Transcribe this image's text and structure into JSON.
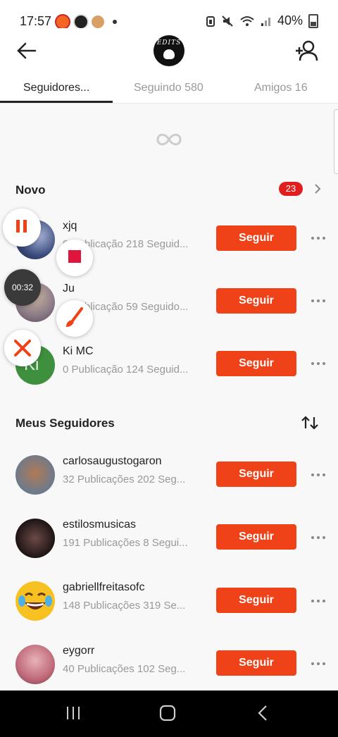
{
  "status_bar": {
    "time": "17:57",
    "battery": "40%"
  },
  "tabs": [
    {
      "label": "Seguidores..."
    },
    {
      "label": "Seguindo 580"
    },
    {
      "label": "Amigos 16"
    }
  ],
  "logo_text": "EDITS",
  "new_section": {
    "title": "Novo",
    "badge": "23",
    "users": [
      {
        "name": "xjq",
        "meta": "0 Publicação   218 Seguid...",
        "button": "Seguir"
      },
      {
        "name": "Ju",
        "meta": "0 Publicação   59 Seguido...",
        "button": "Seguir"
      },
      {
        "name": "Ki MC",
        "meta": "0 Publicação   124 Seguid...",
        "button": "Seguir",
        "initials": "Ki"
      }
    ]
  },
  "followers_section": {
    "title": "Meus Seguidores",
    "users": [
      {
        "name": "carlosaugustogaron",
        "meta": "32 Publicações   202 Seg...",
        "button": "Seguir"
      },
      {
        "name": "estilosmusicas",
        "meta": "191 Publicações   8 Segui...",
        "button": "Seguir"
      },
      {
        "name": "gabriellfreitasofc",
        "meta": "148 Publicações   319 Se...",
        "button": "Seguir"
      },
      {
        "name": "eygorr",
        "meta": "40 Publicações   102 Seg...",
        "button": "Seguir"
      }
    ]
  },
  "recorder": {
    "timer": "00:32"
  },
  "colors": {
    "accent": "#ef4219",
    "badge": "#e01e1e"
  }
}
